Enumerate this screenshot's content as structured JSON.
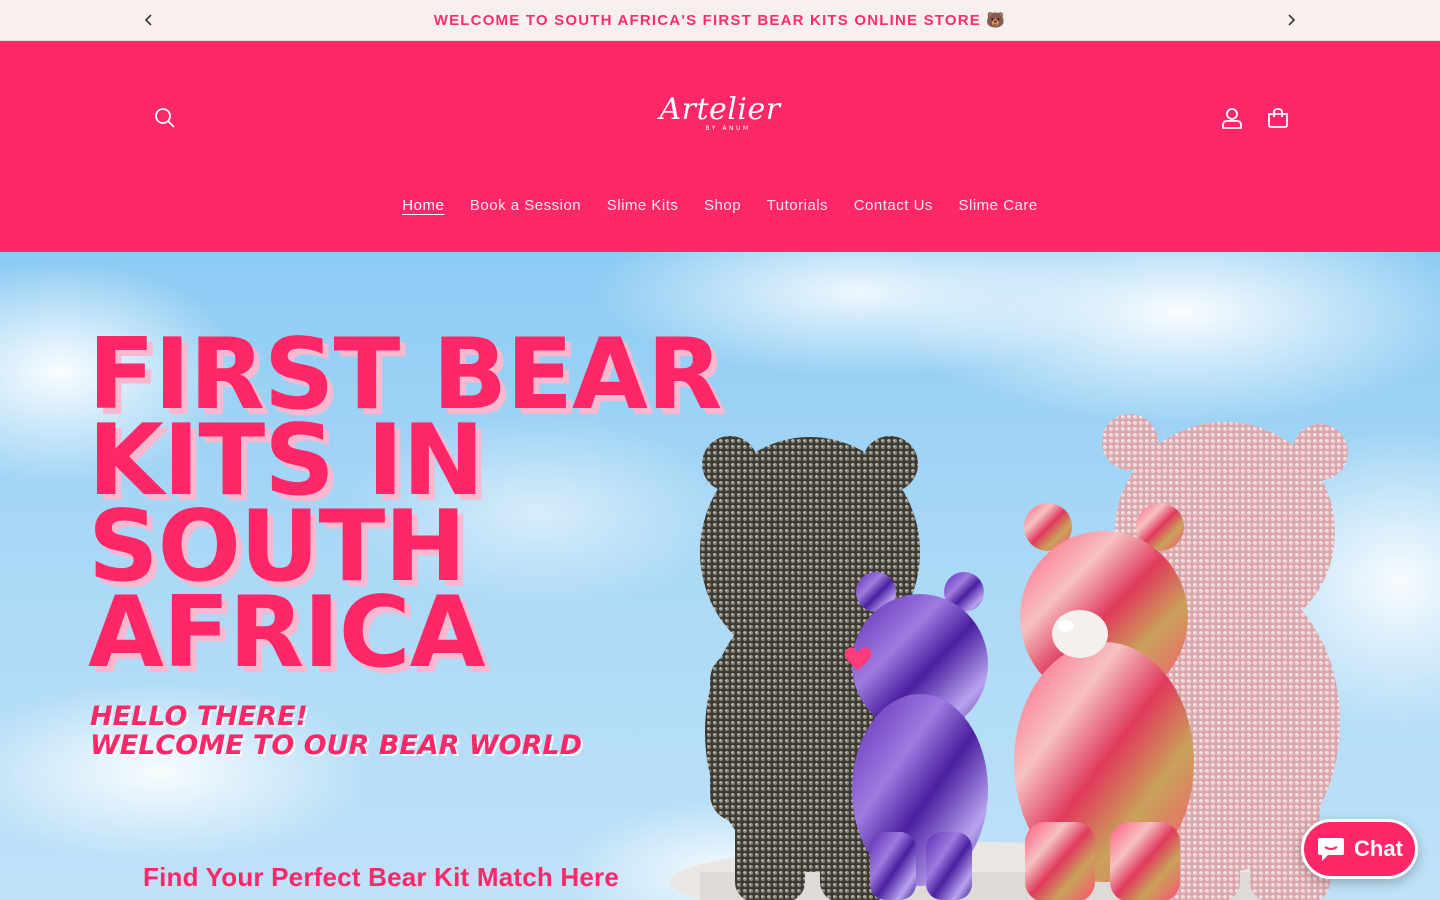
{
  "announcement": {
    "text": "WELCOME TO SOUTH AFRICA'S FIRST BEAR KITS ONLINE STORE 🐻"
  },
  "header": {
    "logo_main": "Artelier",
    "logo_sub": "BY ANUM",
    "nav": [
      {
        "label": "Home",
        "active": true
      },
      {
        "label": "Book a Session"
      },
      {
        "label": "Slime Kits"
      },
      {
        "label": "Shop"
      },
      {
        "label": "Tutorials"
      },
      {
        "label": "Contact Us"
      },
      {
        "label": "Slime Care"
      }
    ],
    "icons": [
      "search-icon",
      "account-icon",
      "cart-icon"
    ]
  },
  "hero": {
    "title": "FIRST BEAR\nKITS IN\nSOUTH\nAFRICA",
    "subtitle": "HELLO THERE!\nWELCOME TO OUR BEAR WORLD",
    "cta": "Find Your Perfect Bear Kit Match Here"
  },
  "chat": {
    "label": "Chat"
  },
  "colors": {
    "brand_pink": "#ff2768",
    "announcement_bg": "#f8f0ef",
    "sky_blue": "#a9d8f6"
  }
}
